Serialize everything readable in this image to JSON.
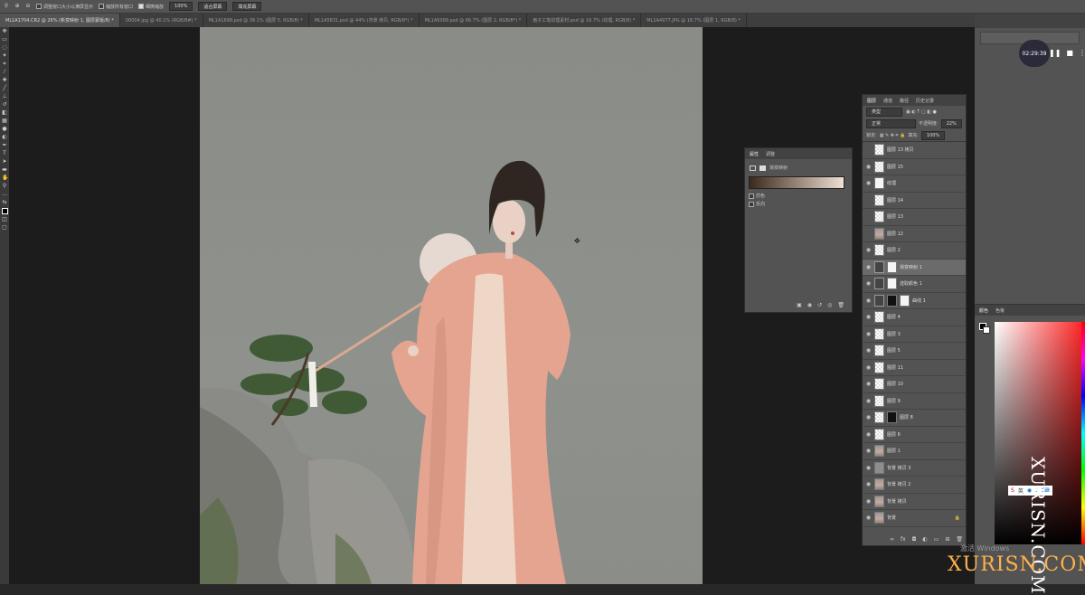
{
  "options_bar": {
    "checkbox1": "调整窗口大小以满屏显示",
    "checkbox2": "缩放所有窗口",
    "checkbox3": "细微缩放",
    "zoom_value": "100%",
    "fit_screen": "适合屏幕",
    "fill_screen": "填充屏幕"
  },
  "tabs": [
    {
      "label": "ML1A1704.CR2 @ 26% (新变映射 1, 图层蒙版/8) *",
      "active": true
    },
    {
      "label": "00004.jpg @ 40.1% (RGB/8#) *"
    },
    {
      "label": "ML1A1698.psd @ 38.1% (图层 5, RGB/8) *"
    },
    {
      "label": "ML1A5831.psd @ 44% (背景 拷贝, RGB/8*) *"
    },
    {
      "label": "ML1A5009.psd @ 66.7% (图层 2, RGB/8*) *"
    },
    {
      "label": "扇子工笔纹理素材.psd @ 16.7% (纹理, RGB/8) *"
    },
    {
      "label": "ML1A4977.JPG @ 16.7% (图层 1, RGB/8) *"
    }
  ],
  "properties": {
    "tab_properties": "属性",
    "tab_adjustments": "调整",
    "adj_name": "渐变映射",
    "dither": "仿色",
    "reverse": "反向",
    "gradient_start": "#3b2a1a",
    "gradient_end": "#f0e0d4"
  },
  "layers_panel": {
    "tabs": [
      "图层",
      "通道",
      "路径",
      "历史记录"
    ],
    "kind": "类型",
    "blend": "正常",
    "opacity_label": "不透明度:",
    "opacity": "22%",
    "lock_label": "锁定:",
    "fill_label": "填充:",
    "fill": "100%",
    "layers": [
      {
        "name": "图层 13 拷贝",
        "thumb": "checker",
        "eye": false
      },
      {
        "name": "图层 15",
        "thumb": "checker",
        "eye": true
      },
      {
        "name": "纹理",
        "thumb": "white",
        "eye": true
      },
      {
        "name": "图层 14",
        "thumb": "checker",
        "eye": false
      },
      {
        "name": "图层 13",
        "thumb": "checker",
        "eye": false
      },
      {
        "name": "图层 12",
        "thumb": "photo",
        "eye": false
      },
      {
        "name": "图层 2",
        "thumb": "checker",
        "eye": true
      },
      {
        "name": "渐变映射 1",
        "thumb": "adj",
        "mask": "white",
        "eye": true,
        "selected": true
      },
      {
        "name": "选取颜色 1",
        "thumb": "adj",
        "mask": "white",
        "eye": true
      },
      {
        "name": "曲线 1",
        "thumb": "adj",
        "mask": "black",
        "mask2": "white",
        "eye": true
      },
      {
        "name": "图层 4",
        "thumb": "checker",
        "eye": true
      },
      {
        "name": "图层 3",
        "thumb": "checker",
        "eye": true
      },
      {
        "name": "图层 5",
        "thumb": "checker",
        "eye": true
      },
      {
        "name": "图层 11",
        "thumb": "checker",
        "eye": true
      },
      {
        "name": "图层 10",
        "thumb": "checker",
        "eye": true
      },
      {
        "name": "图层 9",
        "thumb": "checker",
        "eye": true
      },
      {
        "name": "图层 8",
        "thumb": "checker",
        "mask": "black",
        "eye": true
      },
      {
        "name": "图层 6",
        "thumb": "checker",
        "eye": true
      },
      {
        "name": "图层 1",
        "thumb": "photo",
        "eye": true
      },
      {
        "name": "背景 拷贝 3",
        "thumb": "gray",
        "eye": true
      },
      {
        "name": "背景 拷贝 2",
        "thumb": "photo",
        "eye": true
      },
      {
        "name": "背景 拷贝",
        "thumb": "photo",
        "eye": true
      },
      {
        "name": "背景",
        "thumb": "photo",
        "eye": true,
        "locked": true
      }
    ]
  },
  "right_panels": {
    "color_tab": "颜色",
    "swatches_tab": "色板",
    "timer": "02:29:39"
  },
  "overlay": {
    "watermark_vertical": "XURISN.COM",
    "watermark_bottom": "XURISN.COM",
    "activate_windows": "激活 Windows"
  }
}
